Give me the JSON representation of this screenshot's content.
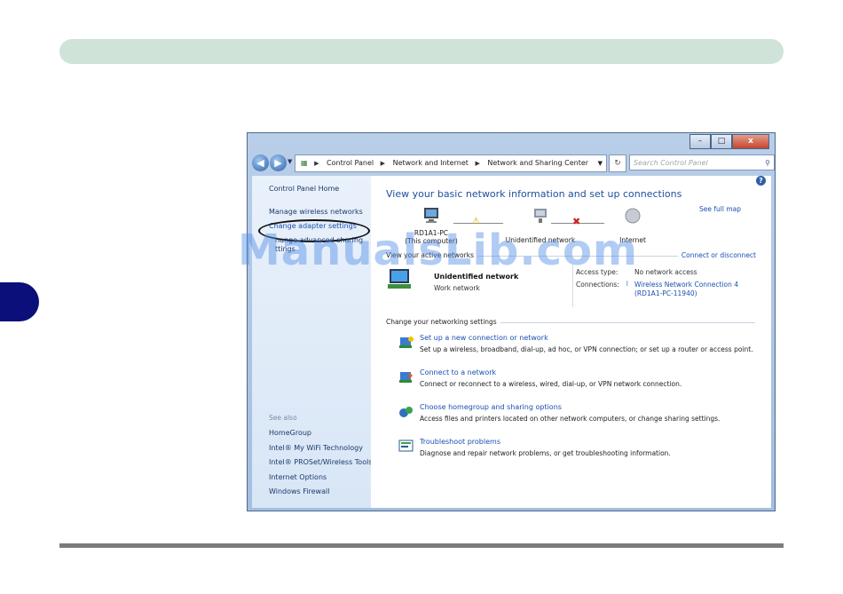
{
  "watermark": "ManualsLib.com",
  "window": {
    "controls": {
      "minimize": "–",
      "maximize": "□",
      "close": "x"
    },
    "breadcrumb": [
      "Control Panel",
      "Network and Internet",
      "Network and Sharing Center"
    ],
    "search_placeholder": "Search Control Panel"
  },
  "sidebar": {
    "home": "Control Panel Home",
    "items": [
      "Manage wireless networks",
      "Change adapter settings",
      "hange advanced sharing",
      "ttings"
    ],
    "see_also_label": "See also",
    "see_also": [
      "HomeGroup",
      "Intel® My WiFi Technology",
      "Intel® PROSet/Wireless Tools",
      "Internet Options",
      "Windows Firewall"
    ]
  },
  "main": {
    "title": "View your basic network information and set up connections",
    "see_full_map": "See full map",
    "map": {
      "computer_name": "RD1A1-PC",
      "computer_sub": "(This computer)",
      "middle": "Unidentified network",
      "end": "Internet"
    },
    "active_networks_label": "View your active networks",
    "connect_disconnect": "Connect or disconnect",
    "network": {
      "name": "Unidentified network",
      "type": "Work network",
      "access_type_label": "Access type:",
      "access_type_value": "No network access",
      "connections_label": "Connections:",
      "connection_line1": "Wireless Network Connection 4",
      "connection_line2": "(RD1A1-PC-11940)"
    },
    "change_settings_label": "Change your networking settings",
    "tasks": [
      {
        "title": "Set up a new connection or network",
        "desc": "Set up a wireless, broadband, dial-up, ad hoc, or VPN connection; or set up a router or access point."
      },
      {
        "title": "Connect to a network",
        "desc": "Connect or reconnect to a wireless, wired, dial-up, or VPN network connection."
      },
      {
        "title": "Choose homegroup and sharing options",
        "desc": "Access files and printers located on other network computers, or change sharing settings."
      },
      {
        "title": "Troubleshoot problems",
        "desc": "Diagnose and repair network problems, or get troubleshooting information."
      }
    ]
  }
}
